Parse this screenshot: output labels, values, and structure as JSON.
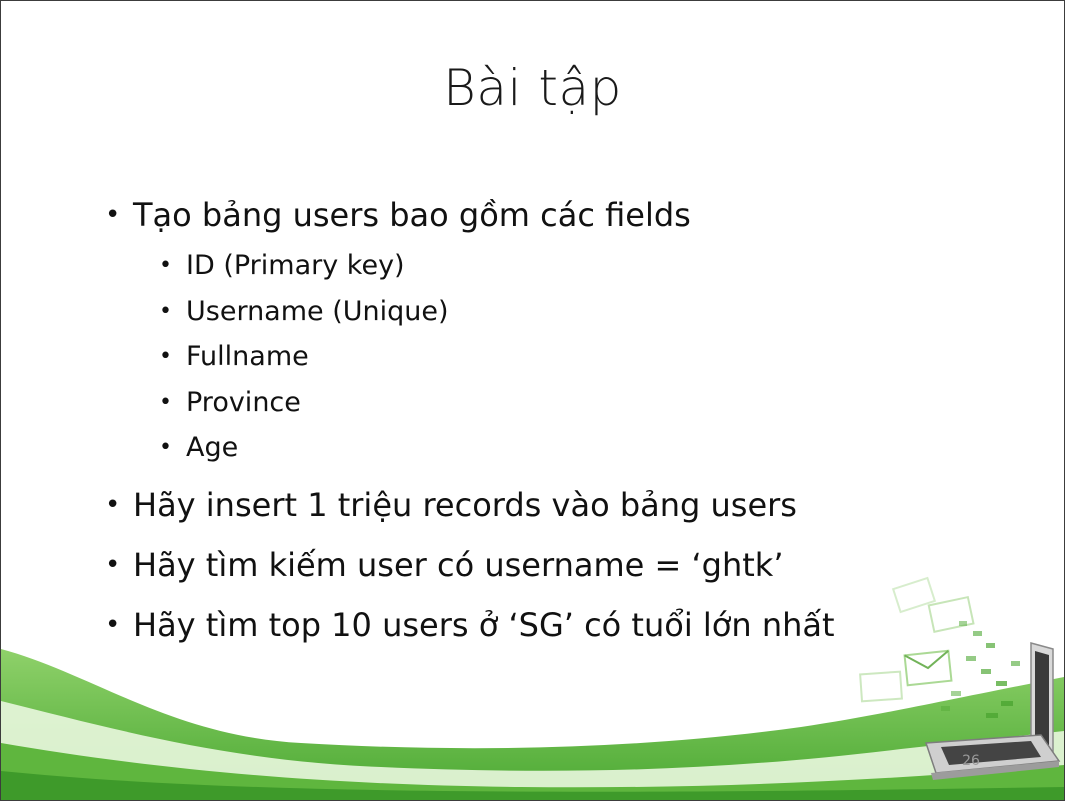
{
  "slide": {
    "title": "Bài tập",
    "bullets": [
      {
        "text": "Tạo bảng users bao gồm các fields",
        "sub": [
          "ID (Primary key)",
          "Username (Unique)",
          "Fullname",
          "Province",
          "Age"
        ]
      },
      {
        "text": "Hãy insert 1 triệu records vào bảng users"
      },
      {
        "text": "Hãy tìm kiếm user có username = ‘ghtk’"
      },
      {
        "text": "Hãy tìm top 10 users ở ‘SG’ có tuổi lớn nhất"
      }
    ],
    "page_number": "26"
  },
  "theme": {
    "accent": "#6fbf4a",
    "accent_dark": "#3e9a2a",
    "accent_light": "#c9ecb5"
  }
}
